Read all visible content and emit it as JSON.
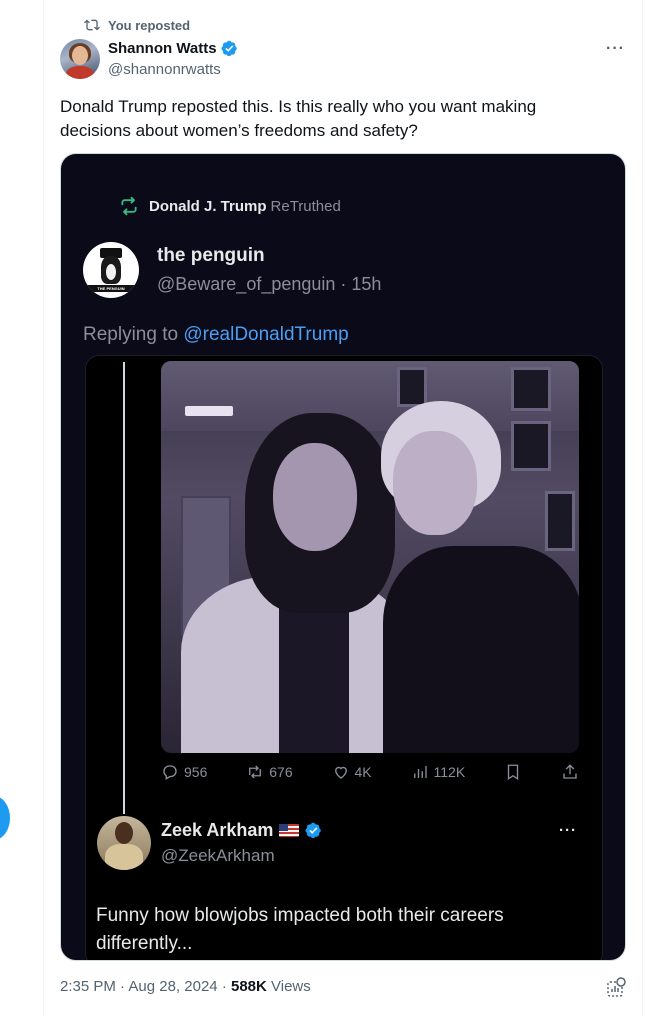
{
  "repost_banner": {
    "label": "You reposted"
  },
  "author": {
    "name": "Shannon Watts",
    "handle": "@shannonrwatts"
  },
  "tweet": {
    "text": "Donald Trump reposted this. Is this really who you want making decisions about women’s freedoms and safety?",
    "time": "2:35 PM",
    "date": "Aug 28, 2024",
    "views_count": "588K",
    "views_label": "Views"
  },
  "screenshot": {
    "retruth": {
      "name": "Donald J. Trump",
      "label": "ReTruthed"
    },
    "post_author": {
      "name": "the penguin",
      "handle": "@Beware_of_penguin",
      "age": "15h",
      "avatar_text": "THE PENGUIN"
    },
    "replying": {
      "prefix": "Replying to",
      "mention": "@realDonaldTrump"
    },
    "metrics": {
      "replies": "956",
      "reposts": "676",
      "likes": "4K",
      "views": "112K"
    },
    "reply": {
      "name": "Zeek Arkham",
      "handle": "@ZeekArkham",
      "text": "Funny how blowjobs impacted both their careers differently..."
    }
  },
  "colors": {
    "accent": "#1d9bf0",
    "text": "#0f1419",
    "muted": "#536471",
    "dark_bg": "#0a0a18"
  }
}
